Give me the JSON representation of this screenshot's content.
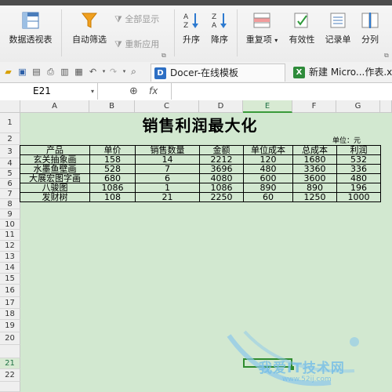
{
  "ribbon": {
    "pivot_label": "数据透视表",
    "autofilter_label": "自动筛选",
    "show_all_label": "全部显示",
    "reapply_label": "重新应用",
    "sort_asc_label": "升序",
    "sort_desc_label": "降序",
    "duplicates_label": "重复项",
    "validity_label": "有效性",
    "record_label": "记录单",
    "split_label": "分列"
  },
  "tabs": [
    {
      "label": "Docer-在线模板"
    },
    {
      "label": "新建 Micro...作表.x"
    }
  ],
  "formula_bar": {
    "name_box": "E21",
    "fx": "fx"
  },
  "columns": [
    "A",
    "B",
    "C",
    "D",
    "E",
    "F",
    "G"
  ],
  "rows": [
    "1",
    "2",
    "3",
    "4",
    "5",
    "6",
    "7",
    "8",
    "9",
    "10",
    "11",
    "12",
    "13",
    "14",
    "15",
    "16",
    "17",
    "18",
    "19",
    "20",
    "21",
    "22"
  ],
  "sheet": {
    "title": "销售利润最大化",
    "unit": "单位：元",
    "headers": [
      "产品",
      "单价",
      "销售数量",
      "金额",
      "单位成本",
      "总成本",
      "利润"
    ],
    "rows": [
      [
        "玄关抽象画",
        "158",
        "14",
        "2212",
        "120",
        "1680",
        "532"
      ],
      [
        "水墨鱼壁画",
        "528",
        "7",
        "3696",
        "480",
        "3360",
        "336"
      ],
      [
        "大展宏图字画",
        "680",
        "6",
        "4080",
        "600",
        "3600",
        "480"
      ],
      [
        "八骏图",
        "1086",
        "1",
        "1086",
        "890",
        "890",
        "196"
      ],
      [
        "发财树",
        "108",
        "21",
        "2250",
        "60",
        "1250",
        "1000"
      ]
    ]
  },
  "watermark": {
    "text": "我爱IT技术网",
    "url": "www.52ij.com"
  }
}
